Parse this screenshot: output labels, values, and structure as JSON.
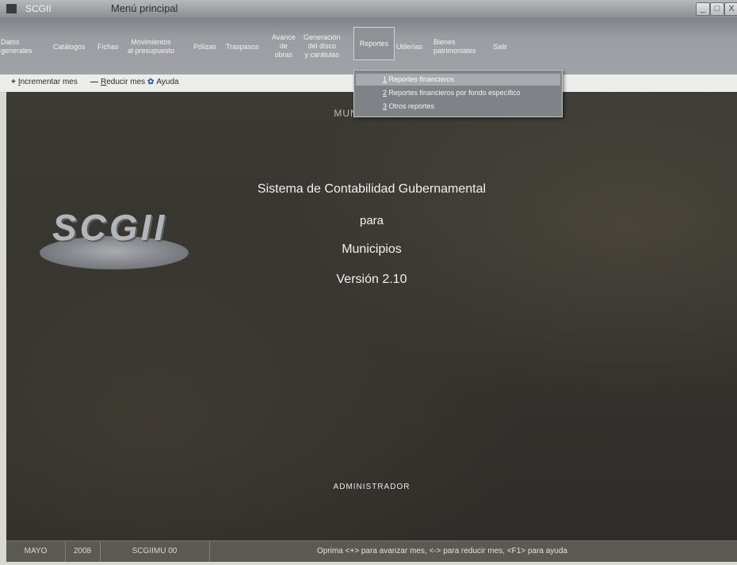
{
  "window": {
    "app_name": "SCGII",
    "title": "Menú principal",
    "controls": {
      "minimize": "_",
      "maximize": "□",
      "close": "X"
    }
  },
  "menu": {
    "items": [
      {
        "label": "Datos\ngenerales"
      },
      {
        "label": "Catálogos"
      },
      {
        "label": "Fichas"
      },
      {
        "label": "Movimientos\nal presupuesto"
      },
      {
        "label": "Pólizas"
      },
      {
        "label": "Traspasos"
      },
      {
        "label": "Avance\nde\nobras"
      },
      {
        "label": "Generación\ndel disco\ny carátulas"
      },
      {
        "label": "Reportes"
      },
      {
        "label": "Utilerías"
      },
      {
        "label": "Bienes\npatrimoniales"
      },
      {
        "label": "Salir"
      }
    ],
    "active": "Reportes"
  },
  "toolbar": {
    "incrementar": {
      "glyph": "+",
      "mnemonic": "I",
      "rest": "ncrementar mes"
    },
    "reducir": {
      "glyph": "—",
      "mnemonic": "R",
      "rest": "educir mes"
    },
    "ayuda": {
      "glyph": "✿",
      "label": "Ayuda"
    }
  },
  "dropdown": {
    "items": [
      {
        "num": "1",
        "label": " Reportes financieros",
        "highlighted": true
      },
      {
        "num": "2",
        "label": " Reportes financieros por fondo específico",
        "highlighted": false
      },
      {
        "num": "3",
        "label": " Otros reportes",
        "highlighted": false
      }
    ]
  },
  "main": {
    "municipio": "MUNICIPIO DE",
    "title_line1": "Sistema de Contabilidad Gubernamental",
    "title_line2": "para",
    "title_line3": "Municipios",
    "version": "Versión 2.10",
    "logo_text": "SCGII",
    "user": "ADMINISTRADOR"
  },
  "statusbar": {
    "month": "MAYO",
    "year": "2008",
    "module": "SCGIIMU 00",
    "message": "Oprima <+> para avanzar mes, <-> para reducir mes, <F1> para ayuda"
  }
}
